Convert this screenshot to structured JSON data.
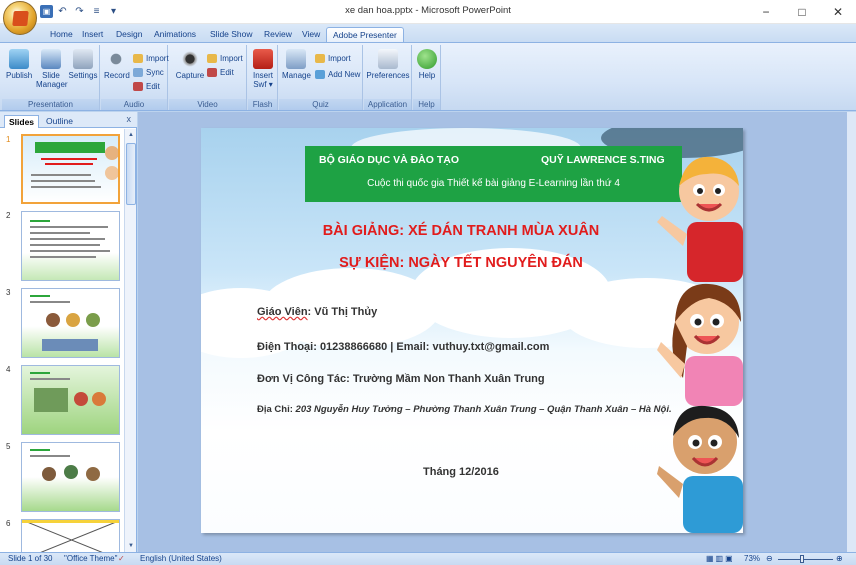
{
  "window": {
    "title": "xe dan hoa.pptx - Microsoft PowerPoint",
    "controls": [
      "−",
      "□",
      "✕"
    ]
  },
  "qat": [
    "save",
    "↶",
    "↷",
    "≡",
    "▾"
  ],
  "tabs": [
    "Home",
    "Insert",
    "Design",
    "Animations",
    "Slide Show",
    "Review",
    "View",
    "Adobe Presenter"
  ],
  "active_tab": "Adobe Presenter",
  "ribbon": {
    "presentation": {
      "label": "Presentation",
      "publish": "Publish",
      "slide_manager": "Slide Manager",
      "settings": "Settings"
    },
    "audio": {
      "label": "Audio",
      "record": "Record",
      "import": "Import",
      "sync": "Sync",
      "edit": "Edit"
    },
    "video": {
      "label": "Video",
      "capture": "Capture",
      "import": "Import",
      "edit": "Edit"
    },
    "flash": {
      "label": "Flash",
      "insert_swf": "Insert Swf ▾"
    },
    "quiz": {
      "label": "Quiz",
      "manage": "Manage",
      "import": "Import",
      "add_new": "Add New"
    },
    "application": {
      "label": "Application",
      "preferences": "Preferences"
    },
    "help": {
      "label": "Help",
      "help": "Help"
    }
  },
  "pane": {
    "tab_slides": "Slides",
    "tab_outline": "Outline",
    "close": "x"
  },
  "thumbnails": [
    "1",
    "2",
    "3",
    "4",
    "5",
    "6"
  ],
  "slide": {
    "header_left": "BỘ GIÁO DỤC VÀ ĐÀO TẠO",
    "header_right": "QUỸ LAWRENCE S.TING",
    "header_sub": "Cuộc thi quốc gia Thiết kế bài giảng E-Learning lần thứ 4",
    "title1": "BÀI GIẢNG: XÉ DÁN TRANH MÙA XUÂN",
    "title2": "SỰ KIỆN: NGÀY TẾT NGUYÊN ĐÁN",
    "teacher_label": "Giáo Viên",
    "teacher_value": ": Vũ Thị Thủy",
    "phone": "Điện Thoại: 01238866680  |  Email: vuthuy.txt@gmail.com",
    "workplace": "Đơn Vị Công Tác: Trường Mầm Non Thanh Xuân Trung",
    "address_label": "Địa Chỉ: ",
    "address_value": "203 Nguyễn Huy Tưởng – Phường Thanh Xuân Trung – Quận Thanh Xuân – Hà Nội.",
    "date": "Tháng 12/2016"
  },
  "status": {
    "slide": "Slide 1 of 30",
    "theme": "\"Office Theme\"",
    "language": "English (United States)",
    "zoom": "73%"
  },
  "colors": {
    "header_green": "#1ea244",
    "title_red": "#e11c1c",
    "ribbon_blue": "#15428b"
  }
}
